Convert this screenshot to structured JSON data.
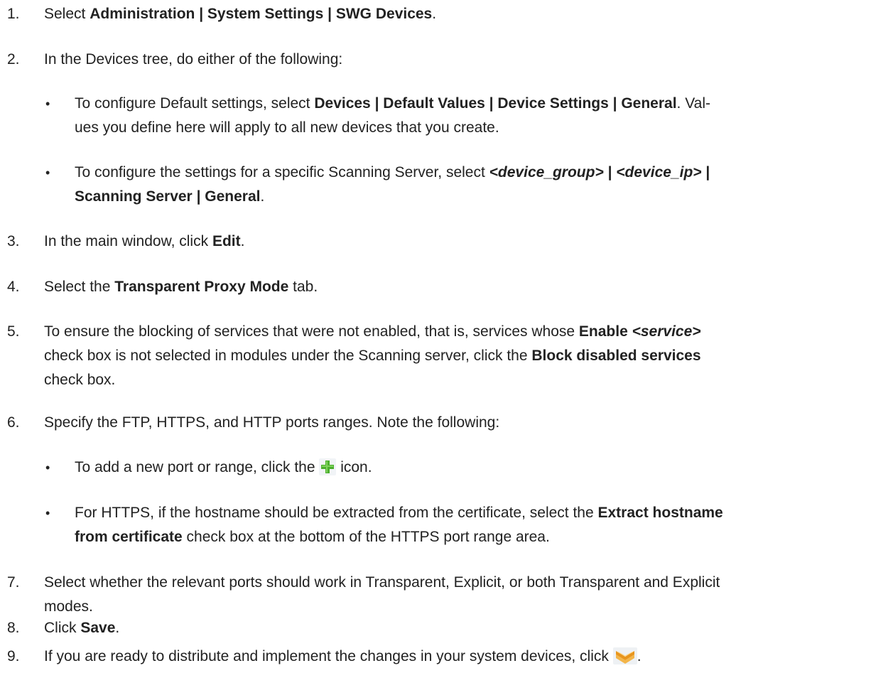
{
  "steps": [
    {
      "num": "1.",
      "t1": "Select ",
      "b1": "Administration | System Settings | SWG Devices",
      "t2": "."
    },
    {
      "num": "2.",
      "t1": "In the Devices tree, do either of the following:"
    },
    {
      "bullet": "•",
      "t1": "To configure Default settings, select ",
      "b1": "Devices | Default Values | Device Settings | General",
      "t2": ". Val-",
      "line2": "ues you define here will apply to all new devices that you create."
    },
    {
      "bullet": "•",
      "t1": "To configure the settings for a specific Scanning Server, select ",
      "bi1": "<device_group>",
      "b1": " | ",
      "bi2": "<device_ip>",
      "b2": " |",
      "line2b": "Scanning Server | General",
      "line2t": "."
    },
    {
      "num": "3.",
      "t1": "In the main window, click ",
      "b1": "Edit",
      "t2": "."
    },
    {
      "num": "4.",
      "t1": "Select the ",
      "b1": "Transparent Proxy Mode",
      "t2": " tab."
    },
    {
      "num": "5.",
      "t1": "To ensure the blocking of services that were not enabled, that is, services whose ",
      "b1": "Enable ",
      "bi1": "<service>",
      "line2": "check box is not selected in modules under the Scanning server, click the ",
      "line2b": "Block disabled services",
      "line3": "check box."
    },
    {
      "num": "6.",
      "t1": "Specify the FTP, HTTPS, and HTTP ports ranges. Note the following:"
    },
    {
      "bullet": "•",
      "t1": "To add a new port or range, click the ",
      "t2": " icon."
    },
    {
      "bullet": "•",
      "t1": "For HTTPS, if the hostname should be extracted from the certificate, select the ",
      "b1": "Extract hostname",
      "line2b": "from certificate",
      "line2": " check box at the bottom of the HTTPS port range area."
    },
    {
      "num": "7.",
      "t1": "Select whether the relevant ports should work in Transparent, Explicit, or both Transparent and Explicit",
      "line2": "modes."
    },
    {
      "num": "8.",
      "t1": "Click ",
      "b1": "Save",
      "t2": "."
    },
    {
      "num": "9.",
      "t1": "If you are ready to distribute and implement the changes in your system devices, click ",
      "t2": "."
    }
  ],
  "icons": {
    "add": "plus-icon",
    "distribute": "distribute-icon"
  },
  "colors": {
    "text": "#222222",
    "plus_green": "#4caf2e",
    "distribute_orange": "#e8951c"
  }
}
